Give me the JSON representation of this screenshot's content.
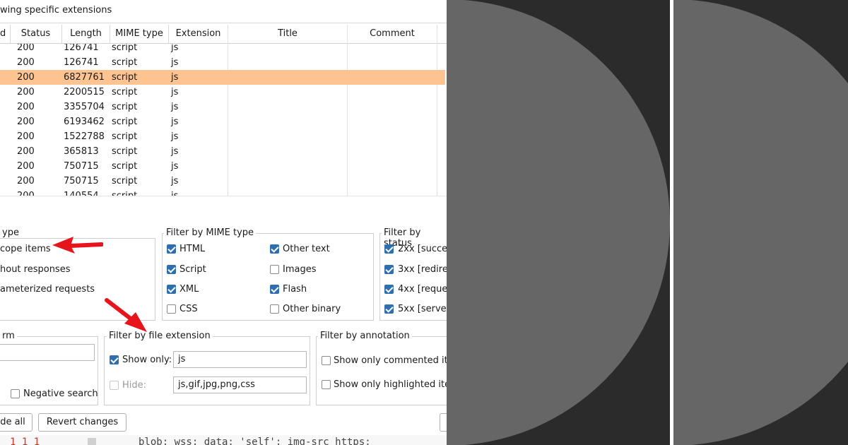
{
  "header": {
    "title": "wing specific extensions"
  },
  "table": {
    "columns": [
      "d",
      "Status",
      "Length",
      "MIME type",
      "Extension",
      "Title",
      "Comment"
    ],
    "rows": [
      {
        "status": "200",
        "length": "126741",
        "mime": "script",
        "ext": "js",
        "selected": false
      },
      {
        "status": "200",
        "length": "126741",
        "mime": "script",
        "ext": "js",
        "selected": false
      },
      {
        "status": "200",
        "length": "6827761",
        "mime": "script",
        "ext": "js",
        "selected": true
      },
      {
        "status": "200",
        "length": "2200515",
        "mime": "script",
        "ext": "js",
        "selected": false
      },
      {
        "status": "200",
        "length": "3355704",
        "mime": "script",
        "ext": "js",
        "selected": false
      },
      {
        "status": "200",
        "length": "6193462",
        "mime": "script",
        "ext": "js",
        "selected": false
      },
      {
        "status": "200",
        "length": "1522788",
        "mime": "script",
        "ext": "js",
        "selected": false
      },
      {
        "status": "200",
        "length": "365813",
        "mime": "script",
        "ext": "js",
        "selected": false
      },
      {
        "status": "200",
        "length": "750715",
        "mime": "script",
        "ext": "js",
        "selected": false
      },
      {
        "status": "200",
        "length": "750715",
        "mime": "script",
        "ext": "js",
        "selected": false
      },
      {
        "status": "200",
        "length": "140554",
        "mime": "script",
        "ext": "js",
        "selected": false
      }
    ]
  },
  "filter_request_type": {
    "title": "ype",
    "items": [
      "cope items",
      "hout responses",
      "ameterized requests"
    ]
  },
  "filter_mime": {
    "title": "Filter by MIME type",
    "items": [
      {
        "label": "HTML",
        "checked": true
      },
      {
        "label": "Other text",
        "checked": true
      },
      {
        "label": "Script",
        "checked": true
      },
      {
        "label": "Images",
        "checked": false
      },
      {
        "label": "XML",
        "checked": true
      },
      {
        "label": "Flash",
        "checked": true
      },
      {
        "label": "CSS",
        "checked": false
      },
      {
        "label": "Other binary",
        "checked": false
      }
    ]
  },
  "filter_status": {
    "title": "Filter by status",
    "items": [
      {
        "label": "2xx  [succe",
        "checked": true
      },
      {
        "label": "3xx  [redire",
        "checked": true
      },
      {
        "label": "4xx  [reque",
        "checked": true
      },
      {
        "label": "5xx  [server",
        "checked": true
      }
    ]
  },
  "filter_search": {
    "title": "rm",
    "negative_label": "Negative search",
    "negative_checked": false
  },
  "filter_extension": {
    "title": "Filter by file extension",
    "show_only_label": "Show only:",
    "show_only_checked": true,
    "show_only_value": "js",
    "hide_label": "Hide:",
    "hide_checked": false,
    "hide_value": "js,gif,jpg,png,css"
  },
  "filter_annotation": {
    "title": "Filter by annotation",
    "commented_label": "Show only commented ite",
    "highlighted_label": "Show only highlighted iter"
  },
  "buttons": {
    "show_all": "de all",
    "revert": "Revert changes"
  },
  "code_strip": {
    "line_numbers": "1  1  1",
    "text": "blob: wss: data: 'self'; img-src https:"
  },
  "colors": {
    "selected_row": "#fdc492",
    "checkbox": "#2f6fb0",
    "arrow": "#e8141c",
    "panel_bg": "#2b2b2b",
    "circle": "#666666"
  },
  "icons": {
    "annotation_arrow": "red-arrow-icon"
  }
}
